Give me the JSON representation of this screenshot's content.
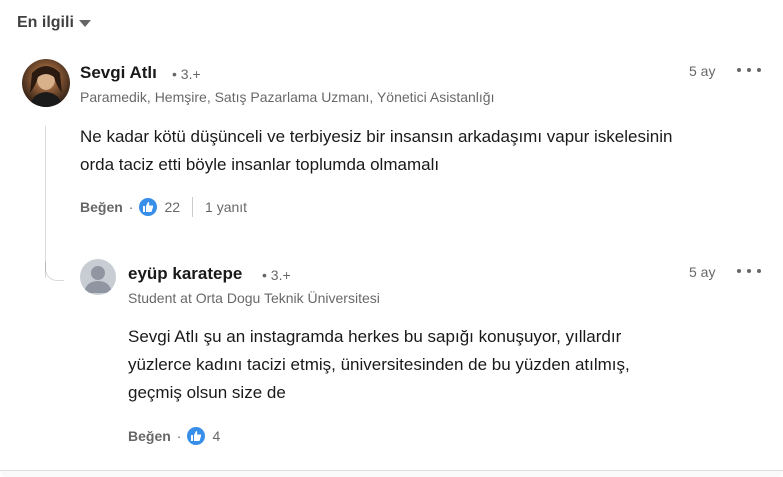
{
  "sort": {
    "label": "En ilgili"
  },
  "comment": {
    "author": "Sevgi Atlı",
    "degree": "• 3.+",
    "headline": "Paramedik, Hemşire, Satış Pazarlama Uzmanı, Yönetici Asistanlığı",
    "time": "5 ay",
    "text_line1": "Ne kadar kötü düşünceli ve terbiyesiz bir insansın arkadaşımı vapur iskelesinin",
    "text_line2": "orda taciz etti böyle insanlar toplumda olmamalı",
    "like_label": "Beğen",
    "separator": "·",
    "reaction_count": "22",
    "reply_label": "1 yanıt"
  },
  "reply": {
    "author": "eyüp karatepe",
    "degree": "• 3.+",
    "headline": "Student at Orta Dogu Teknik Üniversitesi",
    "time": "5 ay",
    "text_line1": "Sevgi Atlı şu an instagramda herkes bu sapığı konuşuyor, yıllardır",
    "text_line2": "yüzlerce kadını tacizi etmiş, üniversitesinden de bu yüzden atılmış,",
    "text_line3": "geçmiş olsun size de",
    "like_label": "Beğen",
    "separator": "·",
    "reaction_count": "4"
  },
  "colors": {
    "reaction_blue": "#378fe9",
    "text_secondary": "#666666"
  },
  "icons": {
    "sort": "caret-down-icon",
    "reaction": "like-thumb-icon",
    "more": "ellipsis-icon"
  }
}
